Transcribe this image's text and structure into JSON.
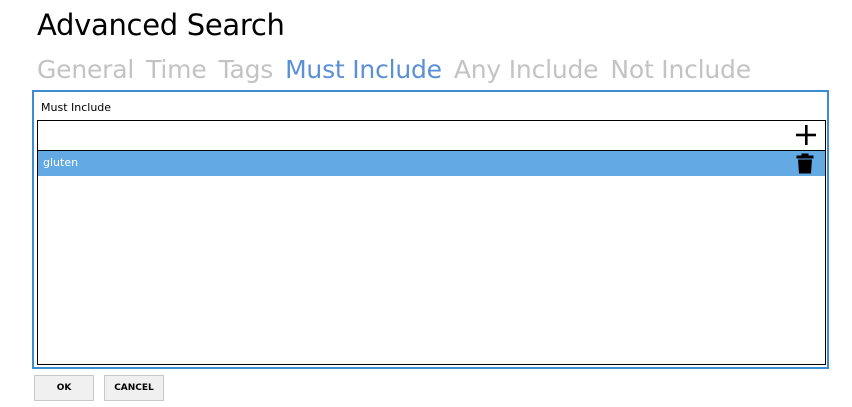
{
  "header": {
    "title": "Advanced Search"
  },
  "tabs": [
    {
      "label": "General",
      "active": false
    },
    {
      "label": "Time",
      "active": false
    },
    {
      "label": "Tags",
      "active": false
    },
    {
      "label": "Must Include",
      "active": true
    },
    {
      "label": "Any Include",
      "active": false
    },
    {
      "label": "Not Include",
      "active": false
    }
  ],
  "panel": {
    "label": "Must Include",
    "input": {
      "value": "",
      "placeholder": ""
    },
    "add_icon": "plus-icon",
    "items": [
      {
        "label": "gluten",
        "selected": true,
        "delete_icon": "trash-icon"
      }
    ]
  },
  "buttons": {
    "ok_label": "OK",
    "cancel_label": "CANCEL"
  },
  "colors": {
    "accent": "#3c8ed0",
    "active_tab": "#5b8fd6",
    "inactive_tab": "#c3c3c3",
    "selected_row": "#63a9e3"
  }
}
